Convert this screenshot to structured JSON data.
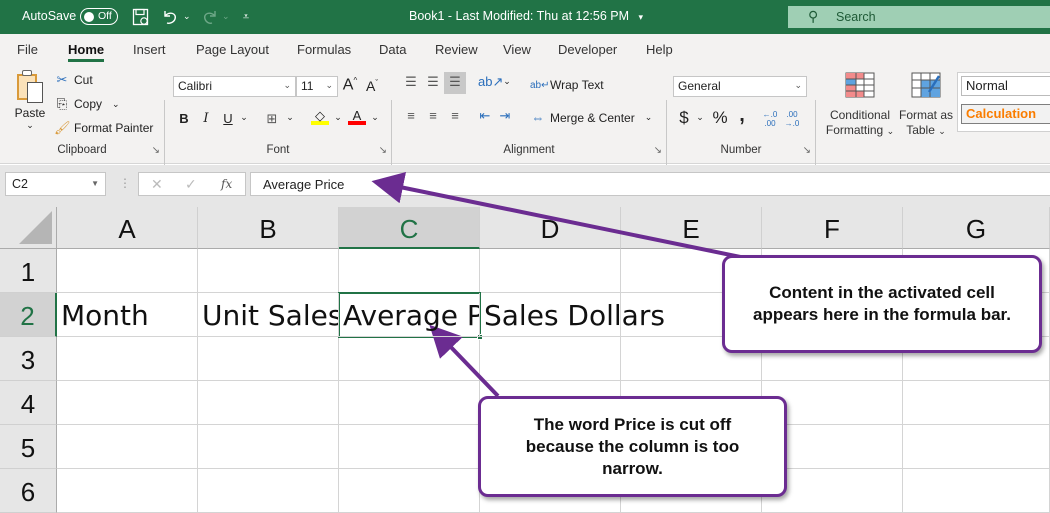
{
  "titlebar": {
    "autosave_label": "AutoSave",
    "autosave_state": "Off",
    "doc_title": "Book1  -  Last Modified: Thu at 12:56 PM",
    "search_placeholder": "Search",
    "icons": [
      "save-icon",
      "undo-icon",
      "redo-icon",
      "customize-toolbar-icon"
    ]
  },
  "ribbon": {
    "tabs": [
      {
        "label": "File"
      },
      {
        "label": "Home",
        "active": true
      },
      {
        "label": "Insert"
      },
      {
        "label": "Page Layout"
      },
      {
        "label": "Formulas"
      },
      {
        "label": "Data"
      },
      {
        "label": "Review"
      },
      {
        "label": "View"
      },
      {
        "label": "Developer"
      },
      {
        "label": "Help"
      }
    ],
    "clipboard": {
      "label": "Clipboard",
      "paste": "Paste",
      "cut": "Cut",
      "copy": "Copy",
      "format_painter": "Format Painter"
    },
    "font": {
      "label": "Font",
      "font_name": "Calibri",
      "font_size": "11",
      "bold": "B",
      "italic": "I",
      "underline": "U",
      "fill_color": "#ffff00",
      "font_color": "#ff0000"
    },
    "alignment": {
      "label": "Alignment",
      "wrap_text": "Wrap Text",
      "merge_center": "Merge & Center"
    },
    "number": {
      "label": "Number",
      "format": "General",
      "currency": "$",
      "percent": "%",
      "comma": ","
    },
    "styles": {
      "conditional_formatting": [
        "Conditional",
        "Formatting"
      ],
      "format_as_table": [
        "Format as",
        "Table"
      ],
      "normal": "Normal",
      "calculation": "Calculation"
    }
  },
  "formula_bar": {
    "name_box": "C2",
    "fx_label": "fx",
    "content": "Average Price"
  },
  "sheet": {
    "columns": [
      "A",
      "B",
      "C",
      "D",
      "E",
      "F",
      "G"
    ],
    "rows": [
      "1",
      "2",
      "3",
      "4",
      "5",
      "6"
    ],
    "selected_column": "C",
    "selected_row": "2",
    "cells": {
      "A2": "Month",
      "B2": "Unit Sales",
      "C2": "Average Price",
      "D2": "Sales Dollars"
    }
  },
  "callouts": {
    "formula_bar": "Content in the activated cell appears here in the formula bar.",
    "cut_off": "The word Price is cut off because the column is too narrow."
  },
  "colors": {
    "excel_green": "#217346",
    "callout_purple": "#6b2c91",
    "calculation_orange": "#fa7d00"
  }
}
